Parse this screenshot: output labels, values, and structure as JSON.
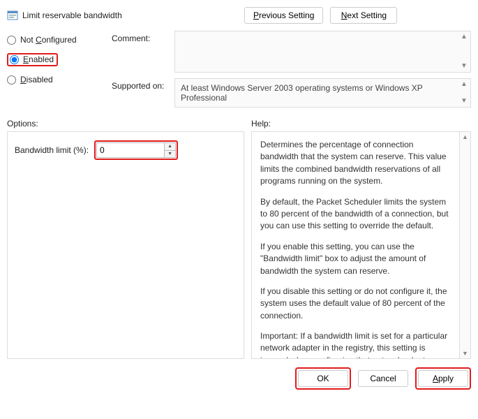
{
  "window": {
    "title": "Limit reservable bandwidth"
  },
  "nav": {
    "prev": "Previous Setting",
    "next": "Next Setting",
    "prev_u": "P",
    "next_u": "N"
  },
  "radios": {
    "not_configured": {
      "label_pre": "Not ",
      "u": "C",
      "label_post": "onfigured"
    },
    "enabled": {
      "label_pre": "",
      "u": "E",
      "label_post": "nabled"
    },
    "disabled": {
      "label_pre": "",
      "u": "D",
      "label_post": "isabled"
    },
    "selected": "enabled"
  },
  "meta": {
    "comment_label": "Comment:",
    "comment_value": "",
    "supported_label": "Supported on:",
    "supported_value": "At least Windows Server 2003 operating systems or Windows XP Professional"
  },
  "sections": {
    "options": "Options:",
    "help": "Help:"
  },
  "options": {
    "bw_label": "Bandwidth limit (%):",
    "bw_value": "0"
  },
  "help": {
    "p1": "Determines the percentage of connection bandwidth that the system can reserve. This value limits the combined bandwidth reservations of all programs running on the system.",
    "p2": "By default, the Packet Scheduler limits the system to 80 percent of the bandwidth of a connection, but you can use this setting to override the default.",
    "p3": "If you enable this setting, you can use the \"Bandwidth limit\" box to adjust the amount of bandwidth the system can reserve.",
    "p4": "If you disable this setting or do not configure it, the system uses the default value of 80 percent of the connection.",
    "p5": "Important: If a bandwidth limit is set for a particular network adapter in the registry, this setting is ignored when configuring that network adapter."
  },
  "buttons": {
    "ok": "OK",
    "cancel": "Cancel",
    "apply": "Apply",
    "apply_u": "A"
  }
}
